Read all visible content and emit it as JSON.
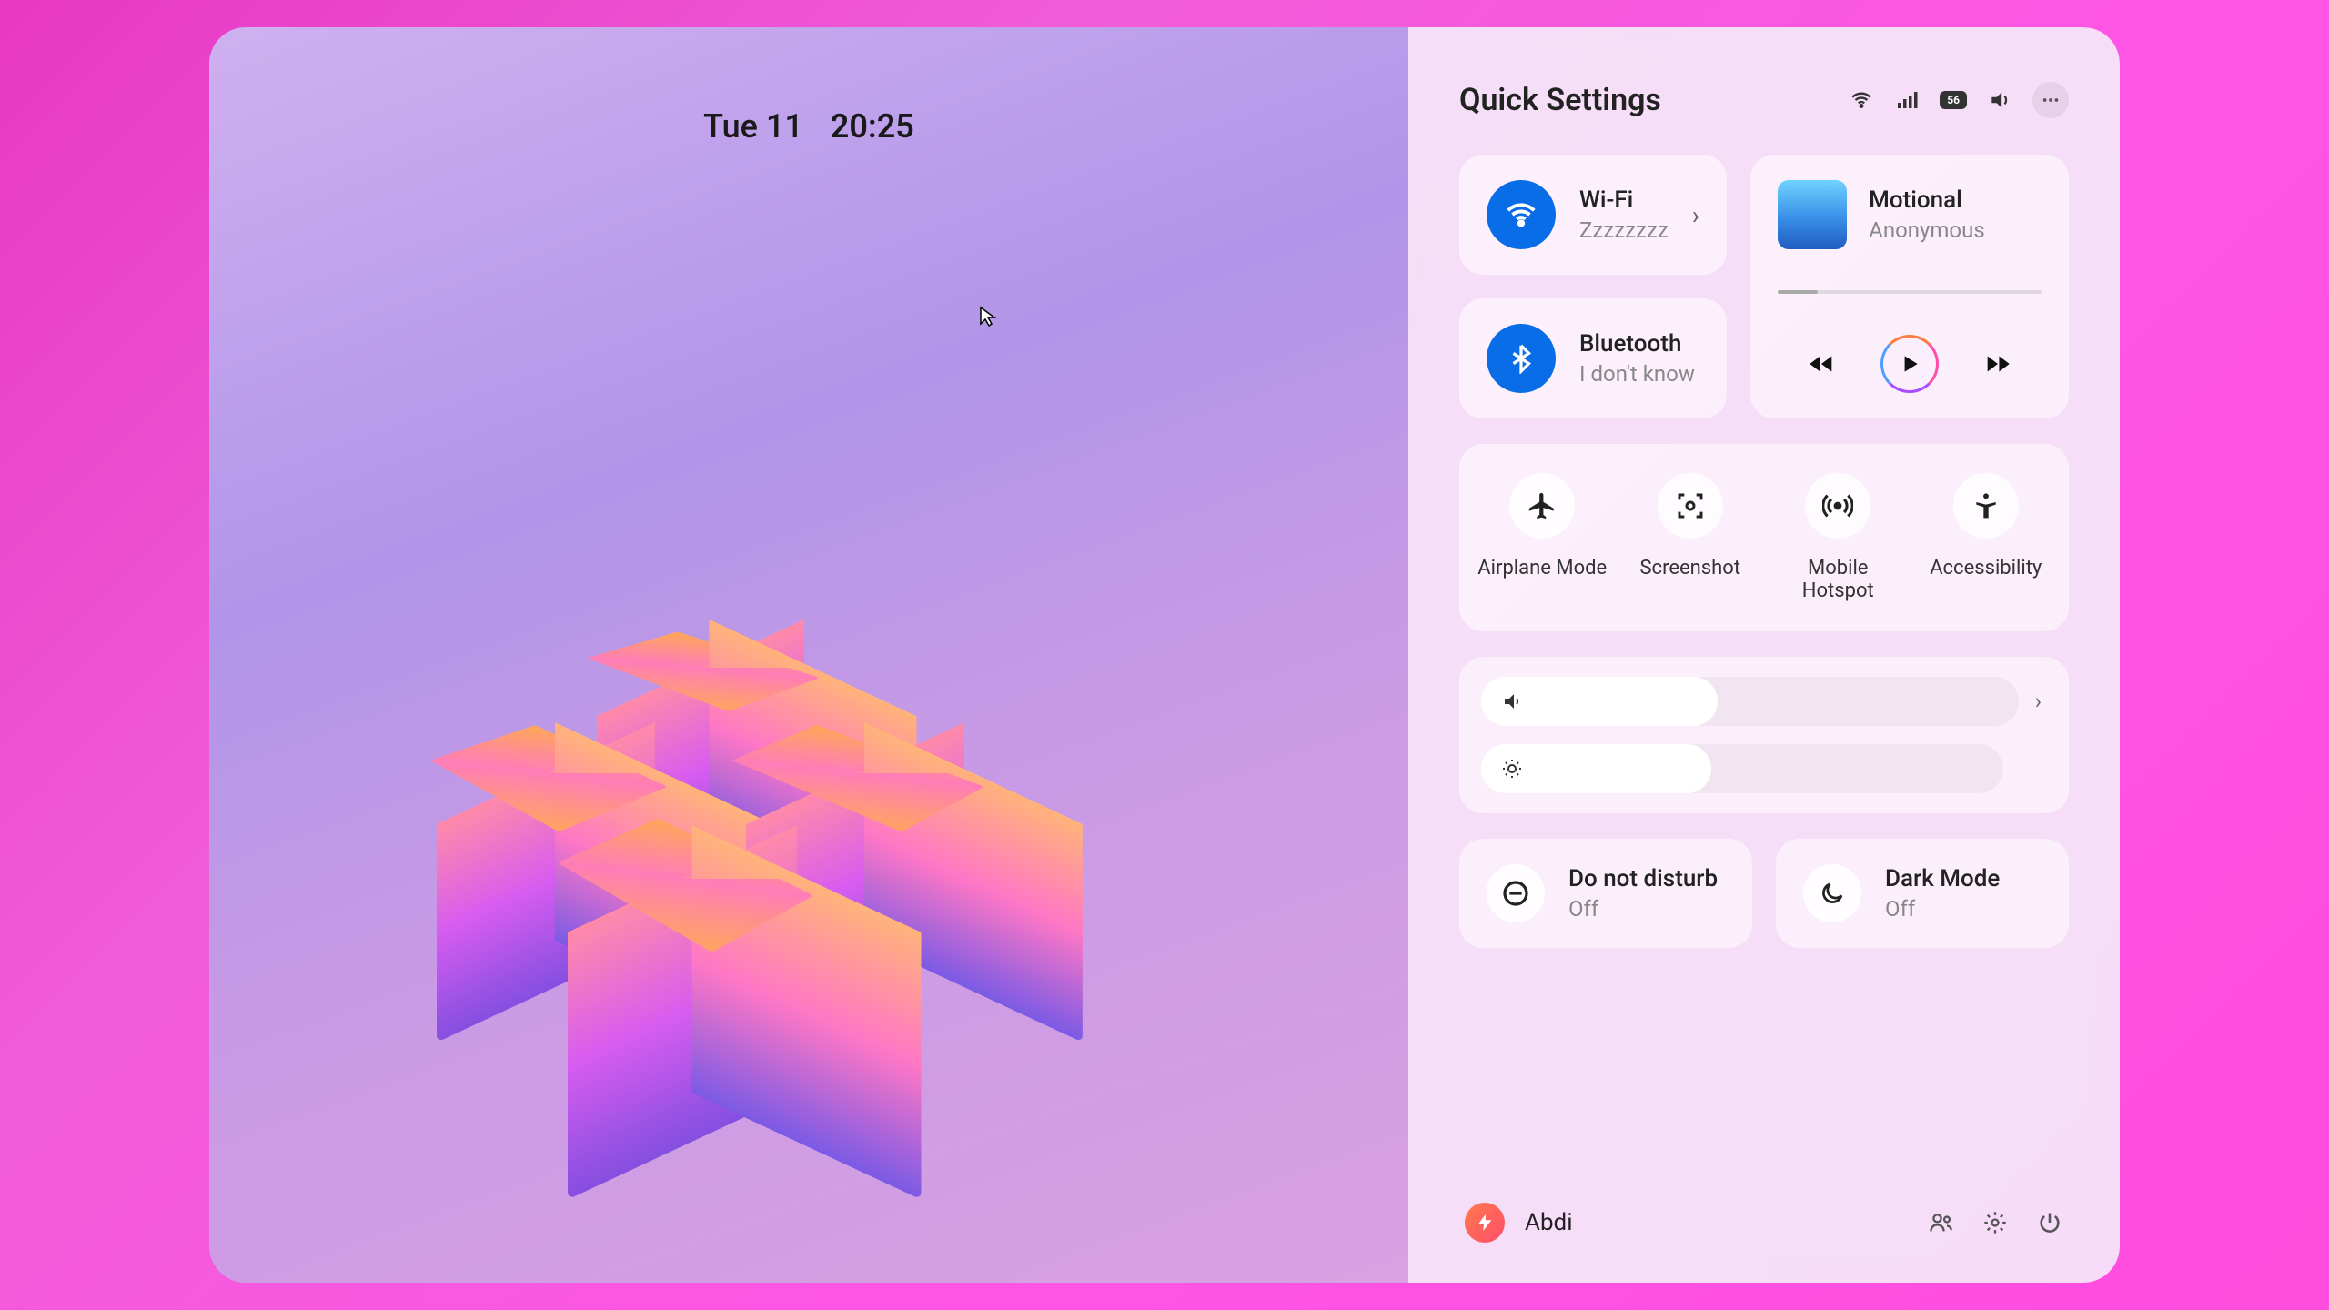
{
  "datetime": {
    "date": "Tue 11",
    "time": "20:25"
  },
  "panel": {
    "title": "Quick Settings",
    "battery": "56",
    "wifi": {
      "title": "Wi-Fi",
      "sub": "Zzzzzzzz"
    },
    "bluetooth": {
      "title": "Bluetooth",
      "sub": "I don't know"
    },
    "media": {
      "track": "Motional",
      "artist": "Anonymous"
    },
    "quick": {
      "airplane": "Airplane Mode",
      "screenshot": "Screenshot",
      "hotspot": "Mobile Hotspot",
      "accessibility": "Accessibility"
    },
    "dnd": {
      "title": "Do not disturb",
      "sub": "Off"
    },
    "dark": {
      "title": "Dark Mode",
      "sub": "Off"
    },
    "user": "Abdi"
  }
}
